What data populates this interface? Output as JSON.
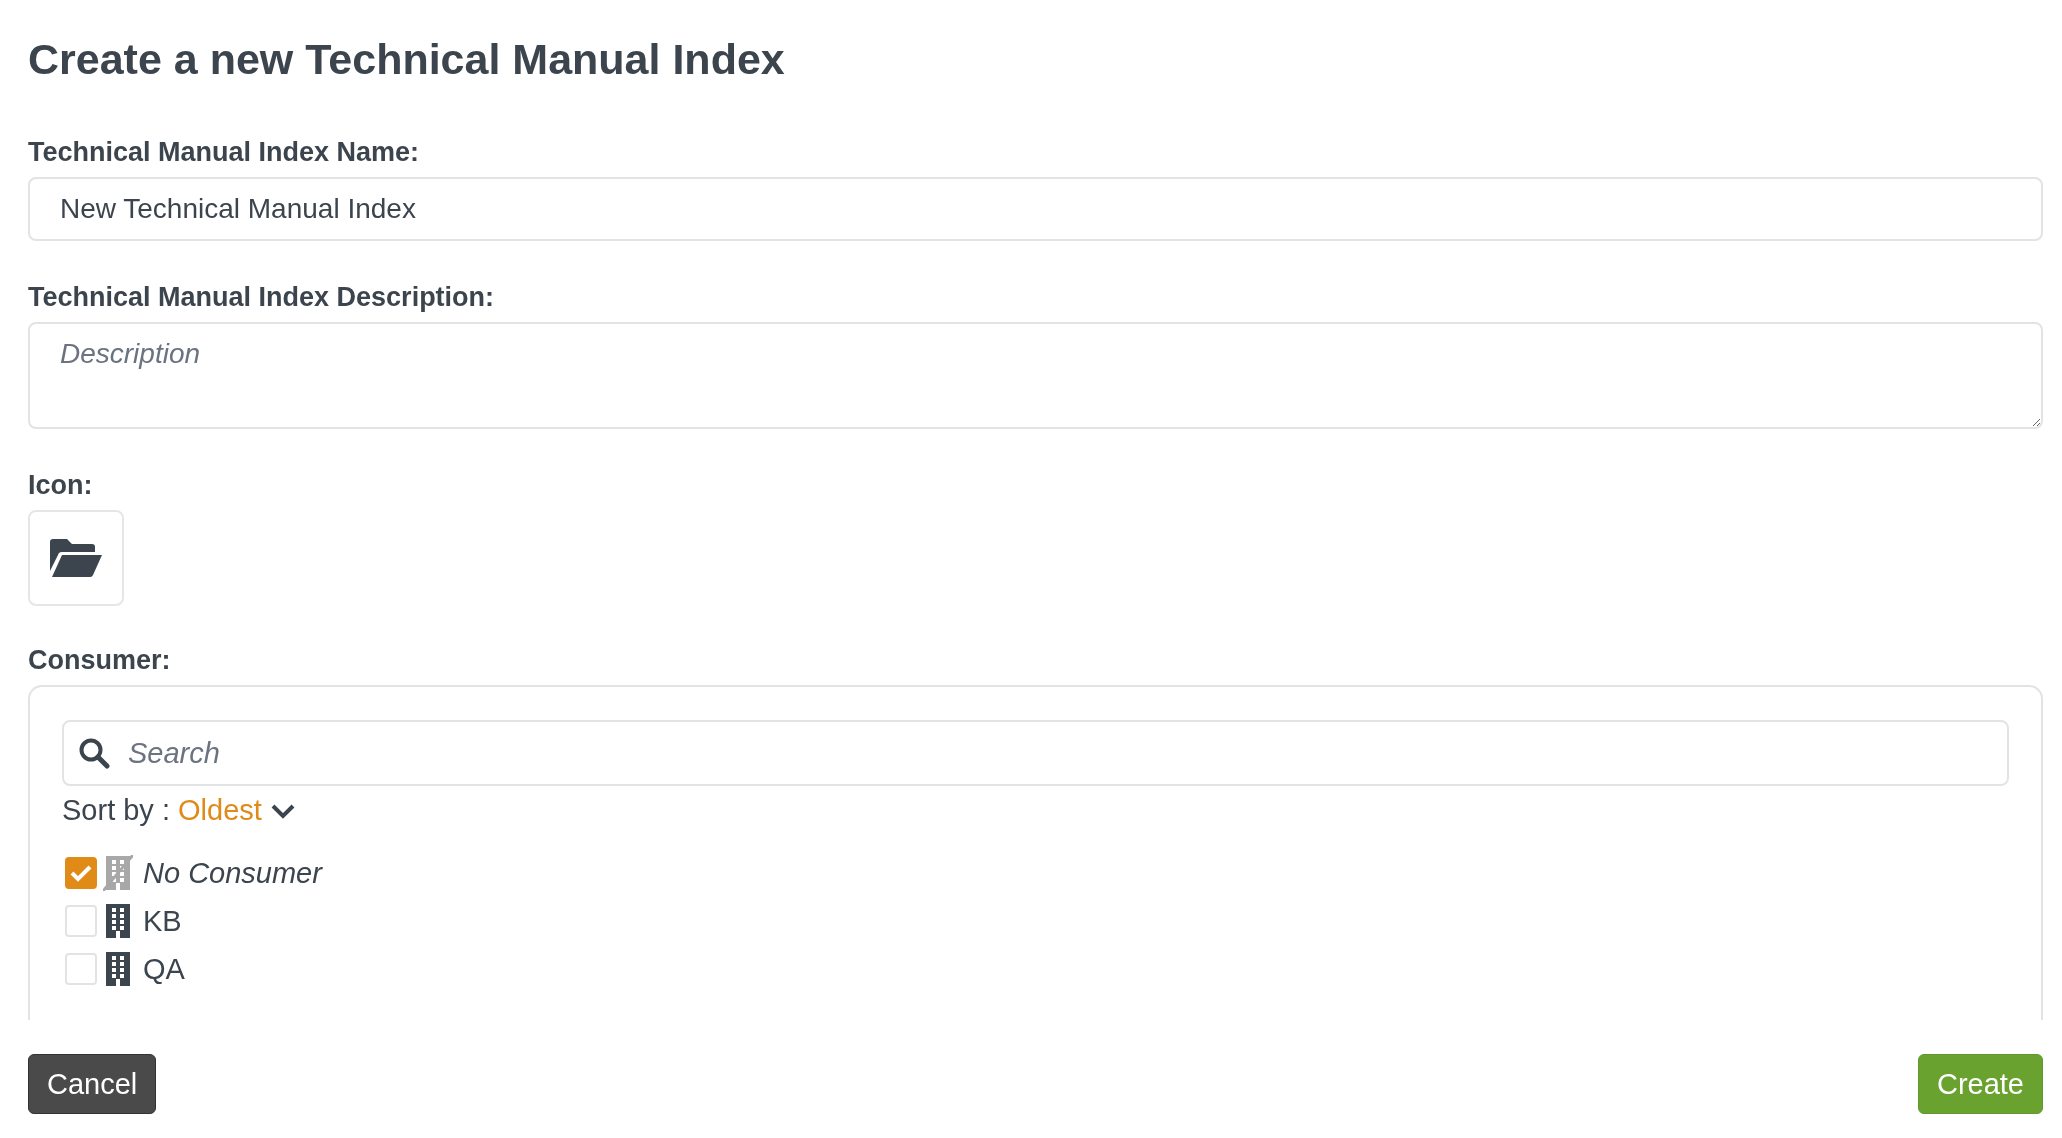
{
  "title": "Create a new Technical Manual Index",
  "name_field": {
    "label": "Technical Manual Index Name:",
    "value": "New Technical Manual Index"
  },
  "description_field": {
    "label": "Technical Manual Index Description:",
    "placeholder": "Description"
  },
  "icon_field": {
    "label": "Icon:"
  },
  "consumer": {
    "label": "Consumer:",
    "search": {
      "placeholder": "Search"
    },
    "sort_label": "Sort by :",
    "sort_value": "Oldest",
    "items": [
      {
        "kind": "none",
        "name": "No Consumer",
        "checked": true
      },
      {
        "kind": "building",
        "name": "KB",
        "checked": false
      },
      {
        "kind": "building",
        "name": "QA",
        "checked": false
      }
    ]
  },
  "buttons": [
    {
      "kind": "cancel",
      "label": "Cancel"
    },
    {
      "kind": "create",
      "label": "Create"
    }
  ]
}
